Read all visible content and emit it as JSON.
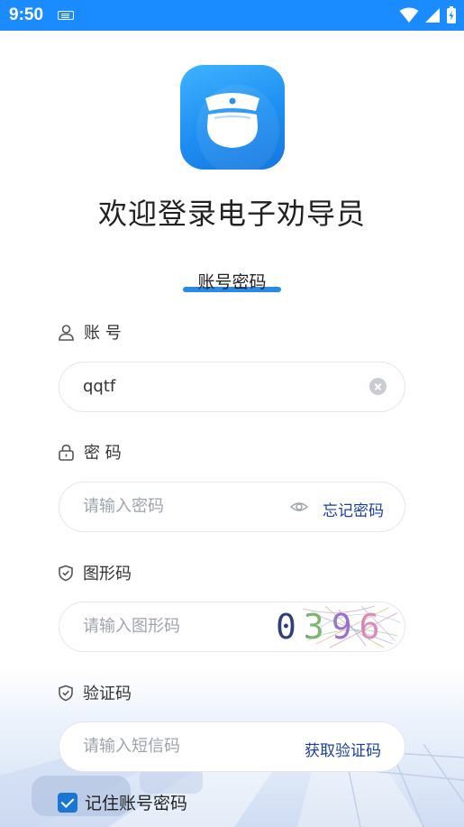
{
  "status_bar": {
    "time": "9:50"
  },
  "welcome_title": "欢迎登录电子劝导员",
  "tab": {
    "label": "账号密码"
  },
  "account": {
    "label": "账 号",
    "value": "qqtf"
  },
  "password": {
    "label": "密 码",
    "placeholder": "请输入密码",
    "forgot_label": "忘记密码"
  },
  "captcha": {
    "label": "图形码",
    "placeholder": "请输入图形码",
    "code": "0396"
  },
  "sms": {
    "label": "验证码",
    "placeholder": "请输入短信码",
    "get_code_label": "获取验证码"
  },
  "remember": {
    "label": "记住账号密码",
    "checked": true
  },
  "colors": {
    "status_bar": "#1a8cff",
    "accent": "#2b8ae6",
    "link": "#1a3fa0",
    "checkbox": "#1976d2"
  }
}
